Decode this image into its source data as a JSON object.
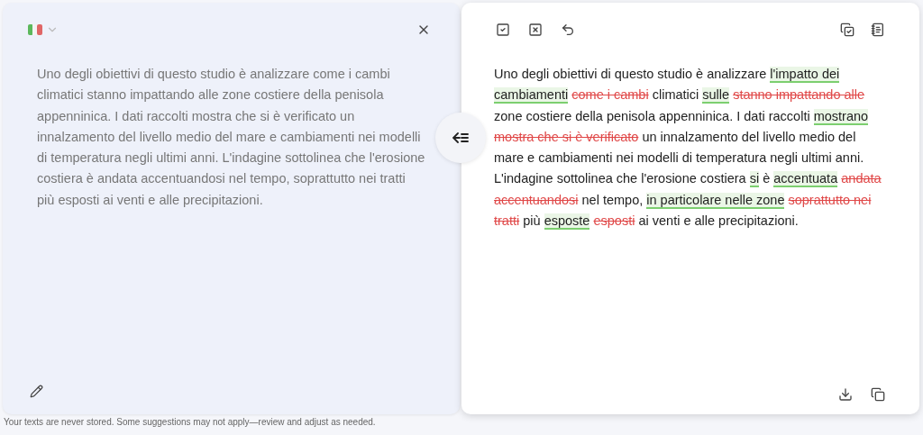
{
  "source": {
    "text": "Uno degli obiettivi di questo studio è analizzare come i cambi climatici stanno impattando alle zone costiere della penisola appenninica. I dati raccolti mostra che si è verificato un innalzamento del livello medio del mare e cambiamenti nei modelli di temperatura negli ultimi anni. L'indagine sottolinea che l'erosione costiera è andata accentuandosi nel tempo, soprattutto nei tratti più esposti ai venti e alle precipitazioni."
  },
  "result": {
    "segments": [
      {
        "kind": "plain",
        "text": "Uno degli obiettivi di questo studio è analizzare"
      },
      {
        "kind": "insert",
        "text": "l'impatto dei cambiamenti"
      },
      {
        "kind": "delete",
        "text": "come i cambi"
      },
      {
        "kind": "plain",
        "text": "climatici"
      },
      {
        "kind": "insert",
        "text": "sulle"
      },
      {
        "kind": "delete",
        "text": "stanno impattando alle"
      },
      {
        "kind": "plain",
        "text": "zone costiere della penisola appenninica. I dati raccolti"
      },
      {
        "kind": "insert",
        "text": "mostrano"
      },
      {
        "kind": "delete",
        "text": "mostra che si è verificato"
      },
      {
        "kind": "plain",
        "text": "un innalzamento del livello medio del mare e cambiamenti nei modelli di temperatura negli ultimi anni. L'indagine sottolinea che l'erosione costiera"
      },
      {
        "kind": "insert",
        "text": "si"
      },
      {
        "kind": "plain",
        "text": "è"
      },
      {
        "kind": "insert",
        "text": "accentuata"
      },
      {
        "kind": "delete",
        "text": "andata accentuandosi"
      },
      {
        "kind": "plain",
        "text": "nel tempo,"
      },
      {
        "kind": "insert",
        "text": "in particolare nelle zone"
      },
      {
        "kind": "delete",
        "text": "soprattutto nei tratti"
      },
      {
        "kind": "plain",
        "text": "più"
      },
      {
        "kind": "insert",
        "text": "esposte"
      },
      {
        "kind": "delete",
        "text": "esposti"
      },
      {
        "kind": "plain",
        "text": "ai venti e alle precipitazioni."
      }
    ]
  },
  "footer": "Your texts are never stored. Some suggestions may not apply—review and adjust as needed."
}
